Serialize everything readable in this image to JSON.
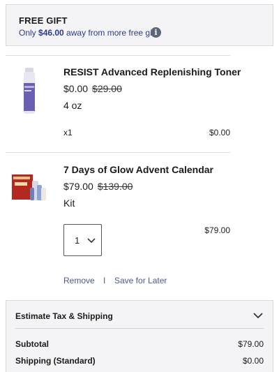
{
  "gift": {
    "title": "FREE GIFT",
    "message_prefix": "Only ",
    "amount": "$46.00",
    "message_suffix": " away from more free gifts",
    "info_icon": "info-icon"
  },
  "items": [
    {
      "name": "RESIST Advanced Replenishing Toner",
      "price": "$0.00",
      "original_price": "$29.00",
      "variant": "4 oz",
      "quantity": "x1",
      "line_total": "$0.00",
      "image_icon": "toner-bottle-image"
    },
    {
      "name": "7 Days of Glow Advent Calendar",
      "price": "$79.00",
      "original_price": "$139.00",
      "variant": "Kit",
      "quantity": "1",
      "line_total": "$79.00",
      "image_icon": "advent-calendar-image",
      "remove_label": "Remove",
      "separator": "I",
      "save_label": "Save for Later"
    }
  ],
  "summary": {
    "estimate_label": "Estimate Tax & Shipping",
    "rows": [
      {
        "label": "Subtotal",
        "value": "$79.00"
      },
      {
        "label": "Shipping (Standard)",
        "value": "$0.00"
      }
    ]
  },
  "colors": {
    "link": "#4a5a8f",
    "gift_text": "#2c3a8c",
    "panel_bg": "#f4f4f6"
  }
}
